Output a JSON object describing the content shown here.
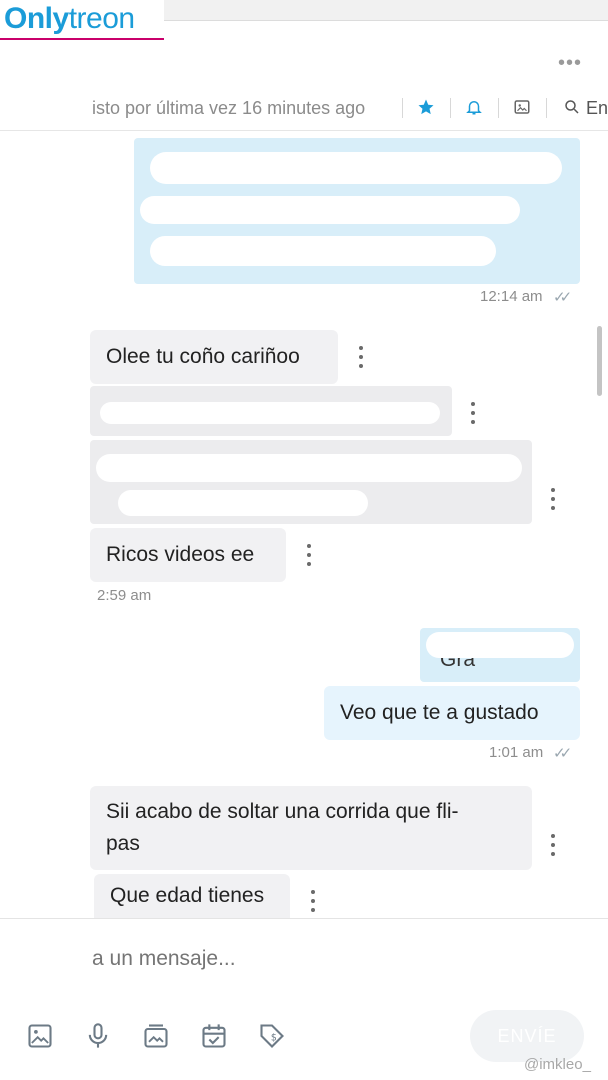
{
  "logo": {
    "part1": "Only",
    "part2": "treon"
  },
  "header": {
    "last_seen": "isto por última vez 16 minutes ago",
    "search_label": "En",
    "icons": [
      "more-icon",
      "star-icon",
      "bell-icon",
      "image-icon",
      "search-icon"
    ]
  },
  "messages": [
    {
      "id": "m1",
      "direction": "out",
      "text": "",
      "time": "12:14 am",
      "read_icon": "✓✓"
    },
    {
      "id": "m2",
      "direction": "in",
      "text": "Olee tu coño cariñoo"
    },
    {
      "id": "m3",
      "direction": "in",
      "text": ""
    },
    {
      "id": "m4",
      "direction": "in",
      "text": ""
    },
    {
      "id": "m5",
      "direction": "in",
      "text": "Ricos videos ee",
      "time": "2:59 am"
    },
    {
      "id": "m6",
      "direction": "out",
      "text": "Gra"
    },
    {
      "id": "m7",
      "direction": "out",
      "text": "Veo que te a gustado",
      "time": "1:01 am",
      "read_icon": "✓✓"
    },
    {
      "id": "m8",
      "direction": "in",
      "text": "Sii acabo de soltar una corrida que fli-\npas"
    },
    {
      "id": "m9",
      "direction": "in",
      "text": "Que edad tienes"
    }
  ],
  "composer": {
    "placeholder": "a un mensaje...",
    "send_label": "ENVÍE",
    "tools": [
      "image-icon",
      "microphone-icon",
      "media-vault-icon",
      "schedule-icon",
      "price-tag-icon"
    ]
  },
  "watermark": "@imkleo_",
  "colors": {
    "accent": "#1b9cd8",
    "logo_underline": "#c9006b",
    "bubble_out": "#e6f4fd",
    "bubble_in": "#f1f1f3"
  }
}
